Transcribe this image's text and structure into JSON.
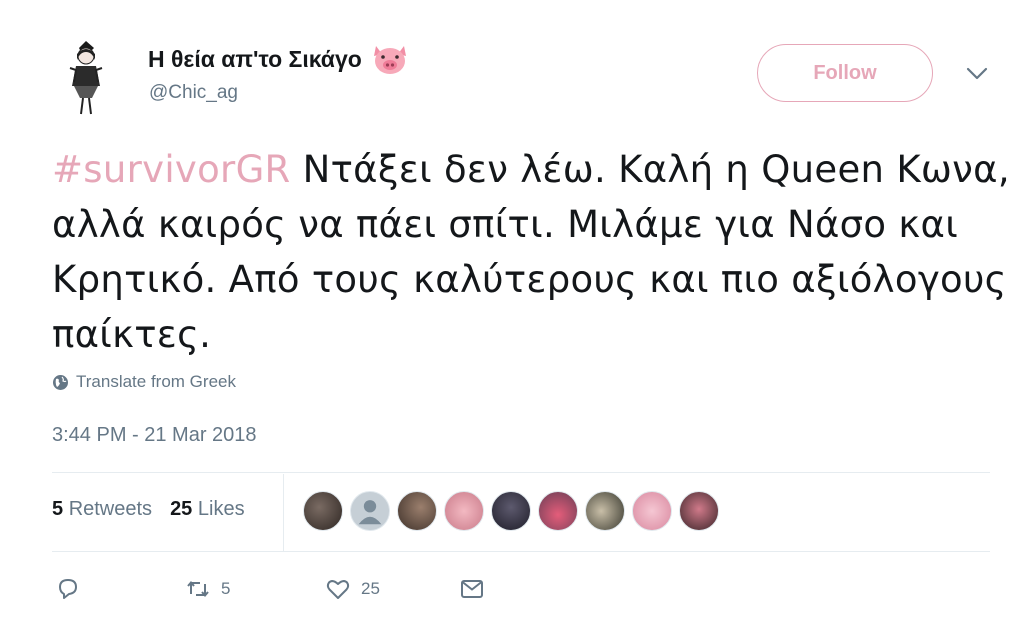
{
  "user": {
    "display_name": "Η θεία απ'το Σικάγο",
    "handle": "@Chic_ag",
    "emoji_icon": "pig-face-icon"
  },
  "follow_button": {
    "label": "Follow"
  },
  "tweet": {
    "hashtag": "#survivorGR",
    "text": " Ντάξει δεν λέω.  Καλή η Queen Κωνα,  αλλά καιρός να πάει σπίτι.  Μιλάμε για Νάσο και Κρητικό.  Από τους καλύτερους και πιο αξιόλογους παίκτες.",
    "translate_label": "Translate from Greek",
    "timestamp": "3:44 PM - 21 Mar 2018"
  },
  "stats": {
    "retweets_count": "5",
    "retweets_label": "Retweets",
    "likes_count": "25",
    "likes_label": "Likes"
  },
  "liked_by_avatars": 9,
  "actions": {
    "retweet_count": "5",
    "like_count": "25"
  },
  "colors": {
    "accent": "#e6a7b8",
    "secondary_text": "#657786",
    "divider": "#e6ecf0"
  }
}
